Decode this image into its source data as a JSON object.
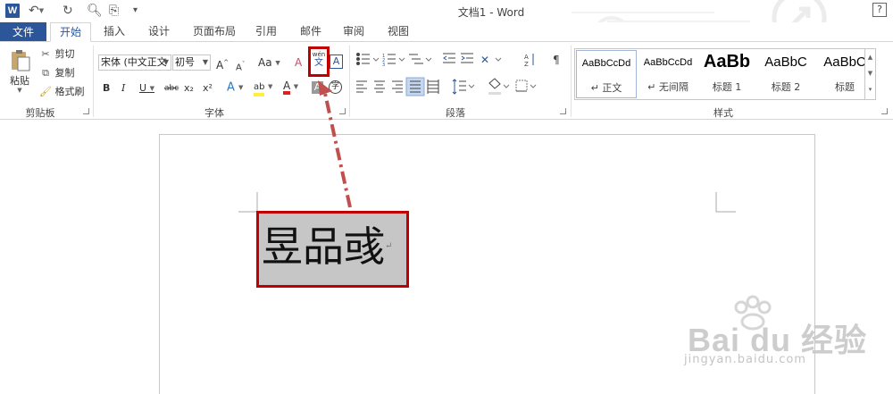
{
  "window": {
    "title": "文档1 - Word",
    "help_label": "?"
  },
  "tabs": {
    "file": "文件",
    "home": "开始",
    "insert": "插入",
    "design": "设计",
    "layout": "页面布局",
    "references": "引用",
    "mailings": "邮件",
    "review": "审阅",
    "view": "视图"
  },
  "clipboard": {
    "paste": "粘贴",
    "cut": "剪切",
    "copy": "复制",
    "format_painter": "格式刷",
    "group": "剪贴板"
  },
  "font": {
    "family": "宋体 (中文正文",
    "size": "初号",
    "group": "字体",
    "phonetic_top": "wén",
    "phonetic_bottom": "文",
    "char_border": "A",
    "aa_label": "Aa",
    "grow_label": "A",
    "shrink_label": "A",
    "bold": "B",
    "italic": "I",
    "underline": "U",
    "strike": "abc",
    "sub": "x₂",
    "sup": "x²",
    "effects": "A",
    "highlight": "ab",
    "color": "A",
    "shade": "A",
    "enclose": "字"
  },
  "paragraph": {
    "group": "段落"
  },
  "styles": {
    "group": "样式",
    "items": [
      {
        "sample": "AaBbCcDd",
        "name": "↵ 正文"
      },
      {
        "sample": "AaBbCcDd",
        "name": "↵ 无间隔"
      },
      {
        "sample": "AaBb",
        "name": "标题 1"
      },
      {
        "sample": "AaBbC",
        "name": "标题 2"
      },
      {
        "sample": "AaBbC",
        "name": "标题"
      }
    ]
  },
  "document": {
    "selected_text": "昱品彧",
    "para_mark": "↵"
  },
  "watermark": {
    "brand": "Bai du 经验",
    "url": "jingyan.baidu.com"
  }
}
